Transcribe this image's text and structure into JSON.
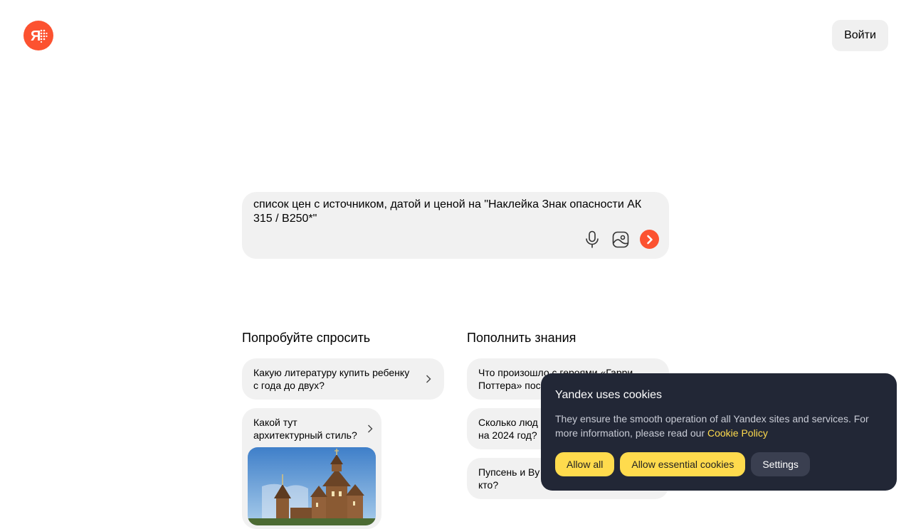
{
  "header": {
    "logo_icon": "yandex-alice-logo-icon",
    "login_label": "Войти"
  },
  "search": {
    "query": "список цен с источником, датой и ценой на \"Наклейка Знак опасности АК 315 / В250*\"",
    "icons": [
      "microphone-icon",
      "image-search-icon",
      "submit-arrow-icon"
    ],
    "accent_color": "#fc5230"
  },
  "suggestions": {
    "try_ask": {
      "title": "Попробуйте спросить",
      "items": [
        {
          "label": "Какую литературу купить ребенку с года до двух?"
        },
        {
          "label": "Какой тут архитектурный стиль?",
          "image": "wooden-church-photo"
        }
      ]
    },
    "knowledge": {
      "title": "Пополнить знания",
      "items": [
        {
          "label": "Что произошло с героями «Гарри Поттера» пос"
        },
        {
          "label": "Сколько люд на 2024 год?"
        },
        {
          "label": "Пупсень и Ву кто?"
        }
      ]
    }
  },
  "cookie_banner": {
    "title": "Yandex uses cookies",
    "text": "They ensure the smooth operation of all Yandex sites and services. For more information, please read our ",
    "link": "Cookie Policy",
    "buttons": {
      "allow_all": "Allow all",
      "allow_essential": "Allow essential cookies",
      "settings": "Settings"
    },
    "bg_color": "#222736",
    "button_color": "#ffdb4d"
  }
}
